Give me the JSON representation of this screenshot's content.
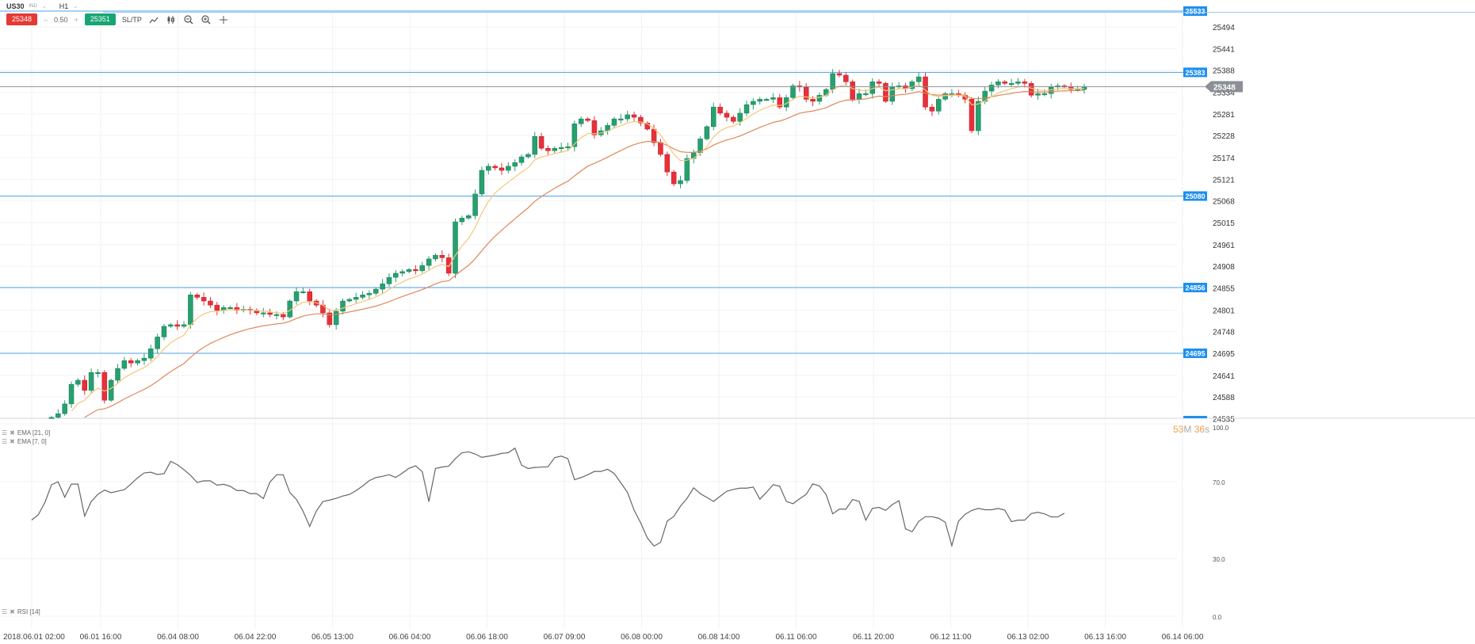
{
  "toolbar": {
    "symbol": "US30",
    "symbol_type": "IND",
    "timeframe": "H1",
    "sell_price": "25348",
    "minus": "–",
    "quantity": "0.50",
    "plus": "+",
    "buy_price": "25351",
    "sltp_label": "SL/TP",
    "icons": [
      "line-chart-icon",
      "candlestick-icon",
      "zoom-out-icon",
      "zoom-in-icon",
      "crosshair-icon"
    ]
  },
  "indicators": {
    "ema21_label": "EMA [21, 0]",
    "ema7_label": "EMA [7, 0]",
    "rsi_label": "RSI [14]"
  },
  "countdown": {
    "minutes": "53",
    "m": "M",
    "seconds": "36",
    "s": "s"
  },
  "colors": {
    "bull": "#26a06f",
    "bear": "#e8303a",
    "level_line": "#4aa3e8",
    "level_tag": "#1e8ff0",
    "ema7": "#f5c77a",
    "ema21": "#e0875a",
    "rsi": "#666666",
    "current": "#8a9096"
  },
  "chart_data": {
    "type": "candlestick",
    "symbol": "US30",
    "timeframe": "H1",
    "ylim": [
      24535,
      25533
    ],
    "y_ticks": [
      25494,
      25441,
      25388,
      25334,
      25281,
      25228,
      25174,
      25121,
      25068,
      25015,
      24961,
      24908,
      24855,
      24801,
      24748,
      24695,
      24641,
      24588,
      24535
    ],
    "x_ticks": [
      "2018.06.01 02:00",
      "06.01 16:00",
      "06.04 08:00",
      "06.04 22:00",
      "06.05 13:00",
      "06.06 04:00",
      "06.06 18:00",
      "06.07 09:00",
      "06.08 00:00",
      "06.08 14:00",
      "06.11 06:00",
      "06.11 20:00",
      "06.12 11:00",
      "06.13 02:00",
      "06.13 16:00",
      "06.14 06:00"
    ],
    "levels": [
      25533,
      25383,
      25080,
      24856,
      24695,
      24534
    ],
    "current_price": 25348,
    "closes": [
      24538,
      24547,
      24571,
      24619,
      24629,
      24604,
      24648,
      24648,
      24580,
      24629,
      24658,
      24677,
      24671,
      24677,
      24683,
      24706,
      24735,
      24761,
      24765,
      24761,
      24765,
      24838,
      24832,
      24823,
      24813,
      24800,
      24807,
      24807,
      24800,
      24803,
      24800,
      24794,
      24794,
      24790,
      24790,
      24784,
      24823,
      24846,
      24846,
      24823,
      24813,
      24794,
      24765,
      24798,
      24823,
      24827,
      24832,
      24838,
      24842,
      24852,
      24865,
      24881,
      24891,
      24895,
      24900,
      24897,
      24910,
      24926,
      24935,
      24929,
      24891,
      25017,
      25026,
      25032,
      25085,
      25143,
      25153,
      25149,
      25143,
      25153,
      25162,
      25176,
      25182,
      25226,
      25197,
      25191,
      25197,
      25199,
      25201,
      25257,
      25269,
      25265,
      25230,
      25240,
      25253,
      25269,
      25269,
      25279,
      25273,
      25259,
      25244,
      25211,
      25182,
      25139,
      25110,
      25118,
      25172,
      25186,
      25220,
      25250,
      25298,
      25283,
      25273,
      25263,
      25283,
      25304,
      25312,
      25317,
      25317,
      25321,
      25298,
      25321,
      25350,
      25347,
      25317,
      25312,
      25327,
      25341,
      25380,
      25376,
      25360,
      25317,
      25331,
      25331,
      25360,
      25356,
      25312,
      25347,
      25350,
      25343,
      25360,
      25372,
      25298,
      25288,
      25317,
      25331,
      25331,
      25327,
      25317,
      25240,
      25312,
      25337,
      25352,
      25360,
      25356,
      25356,
      25360,
      25356,
      25327,
      25331,
      25331,
      25347,
      25350,
      25347,
      25341,
      25341,
      25348
    ],
    "rsi_ylim": [
      0,
      100
    ],
    "rsi_ticks": [
      "100.0",
      "70.0",
      "30.0",
      "0.0"
    ]
  }
}
